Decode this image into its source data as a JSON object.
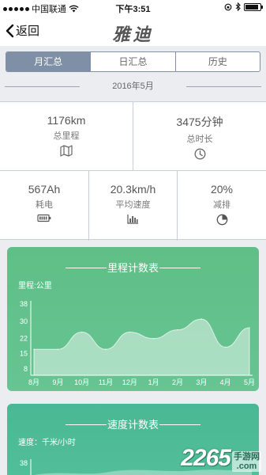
{
  "status_bar": {
    "carrier": "中国联通",
    "time": "下午3:51",
    "battery_level": 0.9
  },
  "nav": {
    "back_label": "返回",
    "title": "雅迪"
  },
  "tabs": [
    {
      "label": "月汇总",
      "active": true
    },
    {
      "label": "日汇总",
      "active": false
    },
    {
      "label": "历史",
      "active": false
    }
  ],
  "period": "2016年5月",
  "stats": {
    "mileage": {
      "value": "1176km",
      "label": "总里程",
      "icon": "map-icon"
    },
    "duration": {
      "value": "3475分钟",
      "label": "总时长",
      "icon": "clock-icon"
    },
    "energy": {
      "value": "567Ah",
      "label": "耗电",
      "icon": "battery-icon"
    },
    "speed": {
      "value": "20.3km/h",
      "label": "平均速度",
      "icon": "bar-chart-icon"
    },
    "emission": {
      "value": "20%",
      "label": "减排",
      "icon": "pie-chart-icon"
    }
  },
  "chart_data": [
    {
      "type": "area",
      "title": "里程计数表",
      "ylabel": "里程:公里",
      "xlabel": "",
      "x": [
        "8月",
        "9月",
        "10月",
        "11月",
        "12月",
        "1月",
        "2月",
        "3月",
        "4月",
        "5月"
      ],
      "y_ticks": [
        8,
        15,
        22,
        30,
        38
      ],
      "ylim": [
        5,
        38
      ],
      "values": [
        17,
        17,
        25,
        17,
        25,
        22,
        26,
        31,
        18,
        27
      ],
      "grid": false,
      "colors": {
        "fill": "#ffffff",
        "background": "#62c18c"
      }
    },
    {
      "type": "area",
      "title": "速度计数表",
      "ylabel": "速度：千米/小时",
      "xlabel": "",
      "y_ticks": [
        38
      ],
      "colors": {
        "fill": "#ffffff",
        "background": "#4fbc97"
      }
    }
  ],
  "watermark": {
    "number": "2265",
    "text_line1": "手游网",
    "text_line2": ".com"
  }
}
